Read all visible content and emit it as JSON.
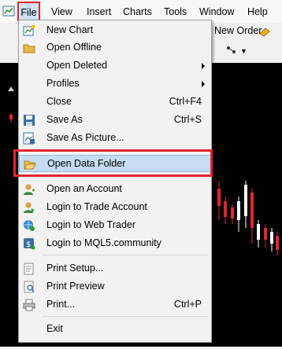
{
  "menubar": {
    "items": [
      "File",
      "View",
      "Insert",
      "Charts",
      "Tools",
      "Window",
      "Help"
    ]
  },
  "toolbar": {
    "new_order_label": "New Order"
  },
  "file_menu": {
    "items": [
      {
        "label": "New Chart",
        "icon": "new-chart-icon"
      },
      {
        "label": "Open Offline",
        "icon": "folder-icon"
      },
      {
        "label": "Open Deleted",
        "submenu": true
      },
      {
        "label": "Profiles",
        "submenu": true
      },
      {
        "label": "Close",
        "shortcut": "Ctrl+F4"
      },
      {
        "label": "Save As",
        "icon": "save-icon",
        "shortcut": "Ctrl+S"
      },
      {
        "label": "Save As Picture...",
        "icon": "save-picture-icon"
      },
      {
        "label": "Open Data Folder",
        "icon": "folder-open-icon",
        "highlighted": true
      },
      {
        "label": "Open an Account",
        "icon": "account-add-icon"
      },
      {
        "label": "Login to Trade Account",
        "icon": "account-login-icon"
      },
      {
        "label": "Login to Web Trader",
        "icon": "web-trader-icon"
      },
      {
        "label": "Login to MQL5.community",
        "icon": "mql5-icon"
      },
      {
        "label": "Print Setup...",
        "icon": "print-setup-icon"
      },
      {
        "label": "Print Preview",
        "icon": "print-preview-icon"
      },
      {
        "label": "Print...",
        "icon": "print-icon",
        "shortcut": "Ctrl+P"
      },
      {
        "label": "Exit"
      }
    ]
  },
  "colors": {
    "highlight_border": "#e0262e",
    "selection_bg": "#c6dcf0",
    "chart_bg": "#000000",
    "candle_red": "#e0262e",
    "candle_white": "#ffffff"
  }
}
